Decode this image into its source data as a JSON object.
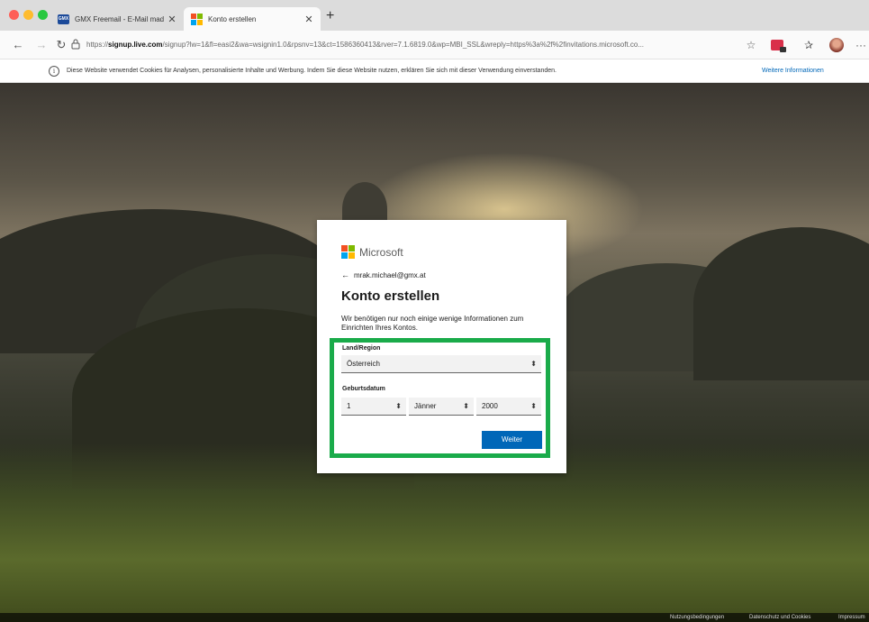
{
  "browser": {
    "tabs": [
      {
        "title": "GMX Freemail - E-Mail made in G",
        "favicon": "gmx-icon",
        "active": false
      },
      {
        "title": "Konto erstellen",
        "favicon": "microsoft-icon",
        "active": true
      }
    ],
    "new_tab": "+",
    "url_prefix": "https://",
    "url_host": "signup.live.com",
    "url_rest": "/signup?lw=1&fl=easi2&wa=wsignin1.0&rpsnv=13&ct=1586360413&rver=7.1.6819.0&wp=MBI_SSL&wreply=https%3a%2f%2finvitations.microsoft.co..."
  },
  "cookie_bar": {
    "text": "Diese Website verwendet Cookies für Analysen, personalisierte Inhalte und Werbung. Indem Sie diese Website nutzen, erklären Sie sich mit dieser Verwendung einverstanden.",
    "link": "Weitere Informationen"
  },
  "card": {
    "brand": "Microsoft",
    "back_email": "mrak.michael@gmx.at",
    "title": "Konto erstellen",
    "description": "Wir benötigen nur noch einige wenige Informationen zum Einrichten Ihres Kontos.",
    "country_label": "Land/Region",
    "country_value": "Österreich",
    "birthdate_label": "Geburtsdatum",
    "day_value": "1",
    "month_value": "Jänner",
    "year_value": "2000",
    "next_button": "Weiter"
  },
  "footer": {
    "terms": "Nutzungsbedingungen",
    "privacy": "Datenschutz und Cookies",
    "imprint": "Impressum"
  },
  "colors": {
    "ms_red": "#f25022",
    "ms_green": "#7fba00",
    "ms_blue": "#00a4ef",
    "ms_yellow": "#ffb900",
    "accent": "#0067b8",
    "highlight": "#1aab4a"
  }
}
